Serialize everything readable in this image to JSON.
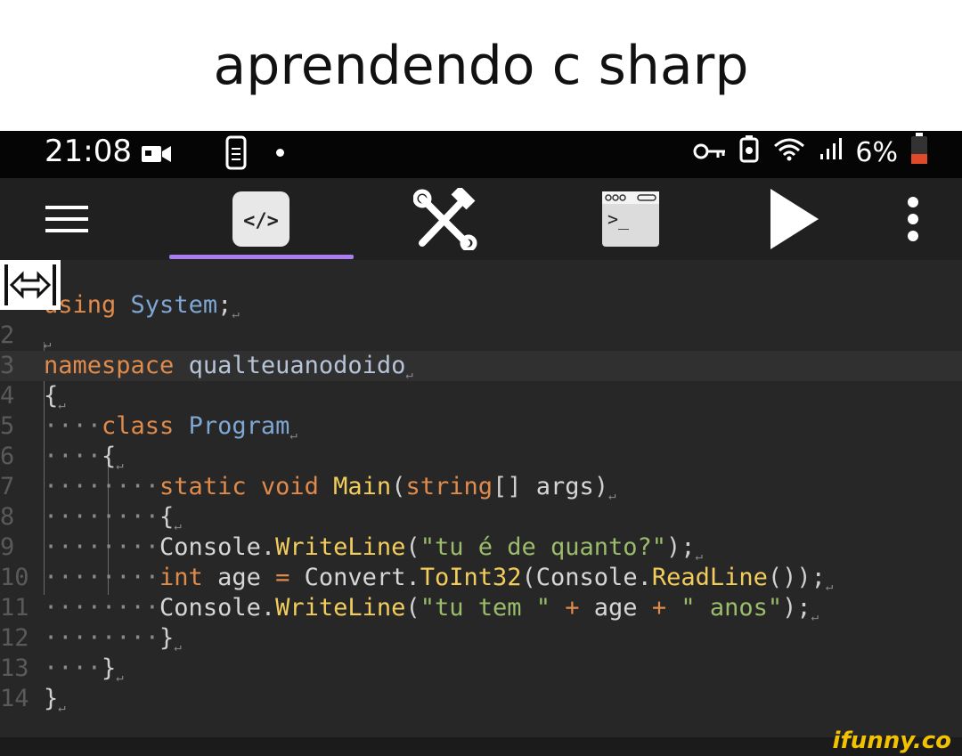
{
  "caption": "aprendendo c sharp",
  "status_bar": {
    "time": "21:08",
    "battery": "6%",
    "icons": [
      "video-camera-icon",
      "phone-icon",
      "dot-icon",
      "key-icon",
      "battery-saver-icon",
      "wifi-icon",
      "signal-icon",
      "battery-icon"
    ]
  },
  "toolbar": {
    "items": [
      "menu-icon",
      "code-tab-icon",
      "tools-icon",
      "terminal-icon",
      "run-icon",
      "more-icon"
    ],
    "active_tab": "code-tab-icon",
    "accent_color": "#a97df0"
  },
  "editor": {
    "line_numbers": [
      "",
      "2",
      "3",
      "4",
      "5",
      "6",
      "7",
      "8",
      "9",
      "10",
      "11",
      "12",
      "13",
      "14"
    ],
    "current_line": 3,
    "lines": [
      [
        {
          "t": "using",
          "c": "kw"
        },
        {
          "t": " ",
          "c": "pl"
        },
        {
          "t": "System",
          "c": "ty"
        },
        {
          "t": ";",
          "c": "sym"
        }
      ],
      [],
      [
        {
          "t": "namespace",
          "c": "kw"
        },
        {
          "t": " ",
          "c": "pl"
        },
        {
          "t": "qualteuanodoido",
          "c": "id"
        }
      ],
      [
        {
          "t": "{",
          "c": "sym"
        }
      ],
      [
        {
          "t": "····",
          "c": "ws"
        },
        {
          "t": "class",
          "c": "kw"
        },
        {
          "t": " ",
          "c": "pl"
        },
        {
          "t": "Program",
          "c": "ty"
        }
      ],
      [
        {
          "t": "····",
          "c": "ws"
        },
        {
          "t": "{",
          "c": "sym"
        }
      ],
      [
        {
          "t": "········",
          "c": "ws"
        },
        {
          "t": "static",
          "c": "kw"
        },
        {
          "t": " ",
          "c": "pl"
        },
        {
          "t": "void",
          "c": "kw"
        },
        {
          "t": " ",
          "c": "pl"
        },
        {
          "t": "Main",
          "c": "fn"
        },
        {
          "t": "(",
          "c": "sym"
        },
        {
          "t": "string",
          "c": "kw"
        },
        {
          "t": "[] ",
          "c": "sym"
        },
        {
          "t": "args",
          "c": "pl"
        },
        {
          "t": ")",
          "c": "sym"
        }
      ],
      [
        {
          "t": "········",
          "c": "ws"
        },
        {
          "t": "{",
          "c": "sym"
        }
      ],
      [
        {
          "t": "········",
          "c": "ws"
        },
        {
          "t": "Console",
          "c": "pl"
        },
        {
          "t": ".",
          "c": "sym"
        },
        {
          "t": "WriteLine",
          "c": "fn"
        },
        {
          "t": "(",
          "c": "sym"
        },
        {
          "t": "\"tu é de quanto?\"",
          "c": "st"
        },
        {
          "t": ");",
          "c": "sym"
        }
      ],
      [
        {
          "t": "········",
          "c": "ws"
        },
        {
          "t": "int",
          "c": "kw"
        },
        {
          "t": " ",
          "c": "pl"
        },
        {
          "t": "age",
          "c": "pl"
        },
        {
          "t": " = ",
          "c": "op"
        },
        {
          "t": "Convert",
          "c": "pl"
        },
        {
          "t": ".",
          "c": "sym"
        },
        {
          "t": "ToInt32",
          "c": "fn"
        },
        {
          "t": "(",
          "c": "sym"
        },
        {
          "t": "Console",
          "c": "pl"
        },
        {
          "t": ".",
          "c": "sym"
        },
        {
          "t": "ReadLine",
          "c": "fn"
        },
        {
          "t": "());",
          "c": "sym"
        }
      ],
      [
        {
          "t": "········",
          "c": "ws"
        },
        {
          "t": "Console",
          "c": "pl"
        },
        {
          "t": ".",
          "c": "sym"
        },
        {
          "t": "WriteLine",
          "c": "fn"
        },
        {
          "t": "(",
          "c": "sym"
        },
        {
          "t": "\"tu tem \"",
          "c": "st"
        },
        {
          "t": " + ",
          "c": "op"
        },
        {
          "t": "age",
          "c": "pl"
        },
        {
          "t": " + ",
          "c": "op"
        },
        {
          "t": "\" anos\"",
          "c": "st"
        },
        {
          "t": ");",
          "c": "sym"
        }
      ],
      [
        {
          "t": "········",
          "c": "ws"
        },
        {
          "t": "}",
          "c": "sym"
        }
      ],
      [
        {
          "t": "····",
          "c": "ws"
        },
        {
          "t": "}",
          "c": "sym"
        }
      ],
      [
        {
          "t": "}",
          "c": "sym"
        }
      ]
    ]
  },
  "watermark": "ifunny.co"
}
